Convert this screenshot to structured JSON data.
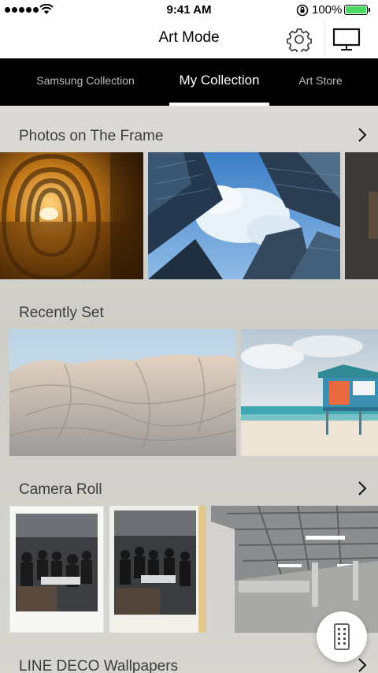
{
  "status_bar": {
    "time": "9:41 AM",
    "battery_percent": "100%",
    "battery_level": 1.0,
    "signal_icon": "signal-dots-icon",
    "wifi_icon": "wifi-icon",
    "lock_icon": "rotation-lock-icon"
  },
  "header": {
    "title": "Art Mode",
    "settings_icon": "gear-icon",
    "tv_icon": "tv-icon"
  },
  "tabs": [
    {
      "label": "Samsung Collection",
      "active": false
    },
    {
      "label": "My Collection",
      "active": true
    },
    {
      "label": "Art Store",
      "active": false
    }
  ],
  "sections": [
    {
      "title": "Photos on The Frame",
      "has_chevron": true
    },
    {
      "title": "Recently Set",
      "has_chevron": false
    },
    {
      "title": "Camera Roll",
      "has_chevron": true
    },
    {
      "title": "LINE DECO Wallpapers",
      "has_chevron": true
    }
  ],
  "remote_icon": "remote-control-icon",
  "colors": {
    "tab_bar_bg": "#000000",
    "active_tab": "#ffffff",
    "inactive_tab": "#bdbdbd",
    "battery_fill": "#4cd964"
  }
}
